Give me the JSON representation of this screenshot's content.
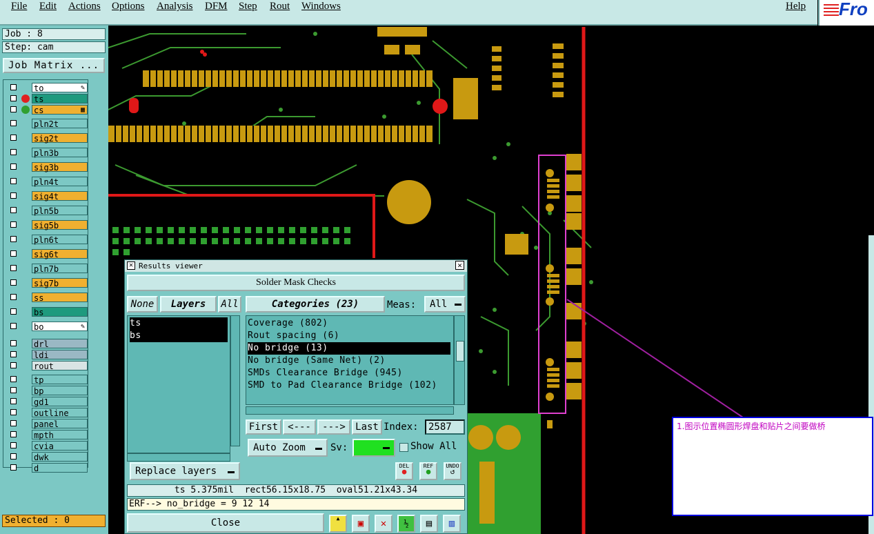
{
  "menu": {
    "items": [
      "File",
      "Edit",
      "Actions",
      "Options",
      "Analysis",
      "DFM",
      "Step",
      "Rout",
      "Windows"
    ],
    "help": "Help",
    "logo_text": "Fro"
  },
  "job": {
    "job_label": "Job : 8",
    "step_label": "Step: cam",
    "matrix_button": "Job Matrix ..."
  },
  "layers": [
    {
      "name": "to",
      "color": "#ffffff",
      "dot": "",
      "mark": "✎"
    },
    {
      "name": "ts",
      "color": "#1e9a7e",
      "dot": "#e02020",
      "mark": ""
    },
    {
      "name": "cs",
      "color": "#f0b030",
      "dot": "#30a030",
      "mark": "▦"
    },
    {
      "name": "pln2t",
      "color": "#7cc8c4",
      "dot": "",
      "mark": ""
    },
    {
      "name": "sig2t",
      "color": "#f0b030",
      "dot": "",
      "mark": ""
    },
    {
      "name": "pln3b",
      "color": "#7cc8c4",
      "dot": "",
      "mark": ""
    },
    {
      "name": "sig3b",
      "color": "#f0b030",
      "dot": "",
      "mark": ""
    },
    {
      "name": "pln4t",
      "color": "#7cc8c4",
      "dot": "",
      "mark": ""
    },
    {
      "name": "sig4t",
      "color": "#f0b030",
      "dot": "",
      "mark": ""
    },
    {
      "name": "pln5b",
      "color": "#7cc8c4",
      "dot": "",
      "mark": ""
    },
    {
      "name": "sig5b",
      "color": "#f0b030",
      "dot": "",
      "mark": ""
    },
    {
      "name": "pln6t",
      "color": "#7cc8c4",
      "dot": "",
      "mark": ""
    },
    {
      "name": "sig6t",
      "color": "#f0b030",
      "dot": "",
      "mark": ""
    },
    {
      "name": "pln7b",
      "color": "#7cc8c4",
      "dot": "",
      "mark": ""
    },
    {
      "name": "sig7b",
      "color": "#f0b030",
      "dot": "",
      "mark": ""
    },
    {
      "name": "ss",
      "color": "#f0b030",
      "dot": "",
      "mark": ""
    },
    {
      "name": "bs",
      "color": "#1e9a7e",
      "dot": "",
      "mark": ""
    },
    {
      "name": "bo",
      "color": "#ffffff",
      "dot": "",
      "mark": "✎"
    },
    {
      "name": "drl",
      "color": "#9ab8c4",
      "dot": "",
      "mark": ""
    },
    {
      "name": "ldi",
      "color": "#9ab8c4",
      "dot": "",
      "mark": ""
    },
    {
      "name": "rout",
      "color": "#d8e4e4",
      "dot": "",
      "mark": ""
    },
    {
      "name": "tp",
      "color": "#7cc8c4",
      "dot": "",
      "mark": ""
    },
    {
      "name": "bp",
      "color": "#7cc8c4",
      "dot": "",
      "mark": ""
    },
    {
      "name": "gd1",
      "color": "#7cc8c4",
      "dot": "",
      "mark": ""
    },
    {
      "name": "outline",
      "color": "#7cc8c4",
      "dot": "",
      "mark": ""
    },
    {
      "name": "panel",
      "color": "#7cc8c4",
      "dot": "",
      "mark": ""
    },
    {
      "name": "mpth",
      "color": "#7cc8c4",
      "dot": "",
      "mark": ""
    },
    {
      "name": "cvia",
      "color": "#7cc8c4",
      "dot": "",
      "mark": ""
    },
    {
      "name": "dwk",
      "color": "#7cc8c4",
      "dot": "",
      "mark": ""
    },
    {
      "name": "d",
      "color": "#7cc8c4",
      "dot": "",
      "mark": ""
    }
  ],
  "selected_label": "Selected : 0",
  "results_viewer": {
    "title": "Results viewer",
    "header": "Solder Mask Checks",
    "none_label": "None",
    "layers_label": "Layers",
    "all_label": "All",
    "layer_items": [
      "ts",
      "bs"
    ],
    "categories_label": "Categories (23)",
    "meas_label": "Meas:",
    "meas_value": "All",
    "categories": [
      {
        "text": "Coverage (802)",
        "selected": false
      },
      {
        "text": "Rout spacing (6)",
        "selected": false
      },
      {
        "text": "No bridge (13)",
        "selected": true
      },
      {
        "text": "No bridge (Same Net) (2)",
        "selected": false
      },
      {
        "text": "SMDs Clearance Bridge (945)",
        "selected": false
      },
      {
        "text": "SMD to Pad Clearance Bridge (102)",
        "selected": false
      }
    ],
    "nav": {
      "first": "First",
      "prev": "<---",
      "next": "--->",
      "last": "Last",
      "index_label": "Index:",
      "index_value": "2587"
    },
    "auto_zoom": "Auto Zoom",
    "sv_label": "Sv:",
    "show_all": "Show All",
    "replace_layers": "Replace layers",
    "del_label": "DEL",
    "ref_label": "REF",
    "undo_label": "UNDO",
    "measure_text": "ts 5.375mil  rect56.15x18.75  oval51.21x43.34",
    "erf_text": "ERF--> no_bridge = 9 12 14",
    "close": "Close"
  },
  "annotation": {
    "text": "1.图示位置椭圆形焊盘和贴片之间要做桥"
  },
  "colors": {
    "panel_bg": "#7cc8c4",
    "copper": "#c89a10",
    "trace": "#3c9a30",
    "mask_green": "#30a030",
    "outline_red": "#e01818",
    "highlight_magenta": "#e040d0"
  }
}
